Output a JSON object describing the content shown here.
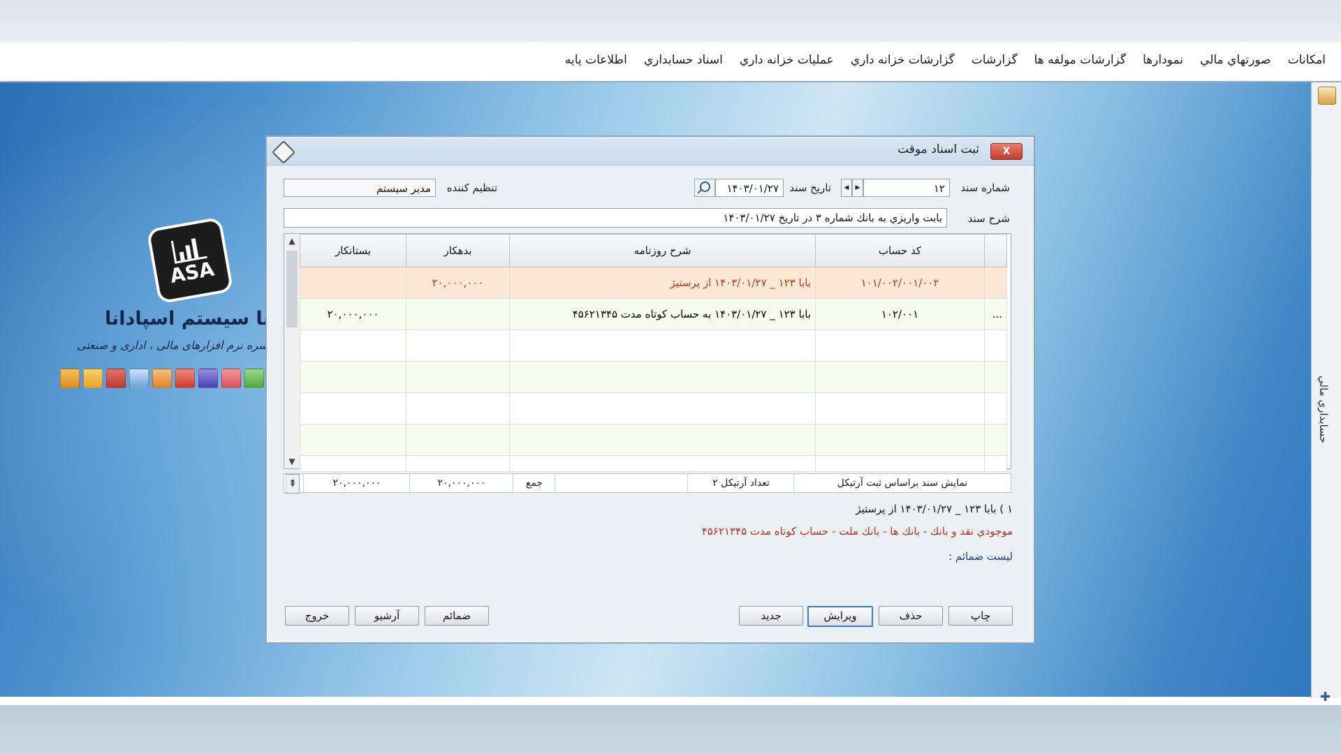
{
  "menu": [
    "اطلاعات پايه",
    "اسناد حسابداري",
    "عمليات خزانه داري",
    "گزارشات خزانه داري",
    "گزارشات",
    "گزارشات مولفه ها",
    "نمودارها",
    "صورتهاي مالي",
    "امكانات"
  ],
  "brand": {
    "logo_text": "ASA",
    "title": "سا سیستم اسپادانا",
    "subtitle": "سره نرم افزارهای مالی ، اداری و صنعتی"
  },
  "side": {
    "label": "حسابداري مالي"
  },
  "dialog": {
    "title": "ثبت اسناد موقت",
    "close": "X",
    "doc_number_label": "شماره سند",
    "doc_number": "۱۲",
    "doc_date_label": "تاريخ سند",
    "doc_date": "۱۴۰۳/۰۱/۲۷",
    "creator_label": "تنظيم كننده",
    "creator": "مدير سيستم",
    "desc_label": "شرح سند",
    "desc": "بابت واريزي به بانك شماره ۳ در تاريخ ۱۴۰۳/۰۱/۲۷",
    "columns": {
      "account": "كد حساب",
      "journal": "شرح روزنامه",
      "debit": "بدهكار",
      "credit": "بستانكار"
    },
    "rows": [
      {
        "marker": "",
        "account": "۱۰۱/۰۰۲/۰۰۱/۰۰۲",
        "journal": "بابا ۱۲۳ _ ۱۴۰۳/۰۱/۲۷ از پرستيژ",
        "debit": "۲۰,۰۰۰,۰۰۰",
        "credit": ""
      },
      {
        "marker": "...",
        "account": "۱۰۲/۰۰۱",
        "journal": "بابا ۱۲۳ _ ۱۴۰۳/۰۱/۲۷ به حساب كوتاه مدت ۴۵۶۲۱۳۴۵",
        "debit": "",
        "credit": "۲۰,۰۰۰,۰۰۰"
      },
      {
        "marker": "",
        "account": "",
        "journal": "",
        "debit": "",
        "credit": ""
      },
      {
        "marker": "",
        "account": "",
        "journal": "",
        "debit": "",
        "credit": ""
      },
      {
        "marker": "",
        "account": "",
        "journal": "",
        "debit": "",
        "credit": ""
      },
      {
        "marker": "",
        "account": "",
        "journal": "",
        "debit": "",
        "credit": ""
      },
      {
        "marker": "",
        "account": "",
        "journal": "",
        "debit": "",
        "credit": ""
      }
    ],
    "footer": {
      "view_mode": "نمايش سند براساس ثبت آرتيكل",
      "article_count": "تعداد آرتيكل ۲",
      "sum_label": "جمع",
      "debit_total": "۲۰,۰۰۰,۰۰۰",
      "credit_total": "۲۰,۰۰۰,۰۰۰"
    },
    "info_line1": "۱ ) بابا ۱۲۳ _ ۱۴۰۳/۰۱/۲۷ از پرستيژ",
    "info_line2": "موجودي نقد و بانك - بانك ها - بانك ملت - حساب كوتاه مدت ۴۵۶۲۱۳۴۵",
    "attachments_label": "ليست ضمائم :",
    "buttons": {
      "print": "چاپ",
      "delete": "حذف",
      "edit": "ويرايش",
      "new": "جديد",
      "attachments": "ضمائم",
      "archive": "آرشيو",
      "exit": "خروج"
    }
  },
  "colors": {
    "selected_row_text": "#c23a12",
    "info_line2": "#b4331a",
    "attachments_label": "#1f3f8a"
  }
}
